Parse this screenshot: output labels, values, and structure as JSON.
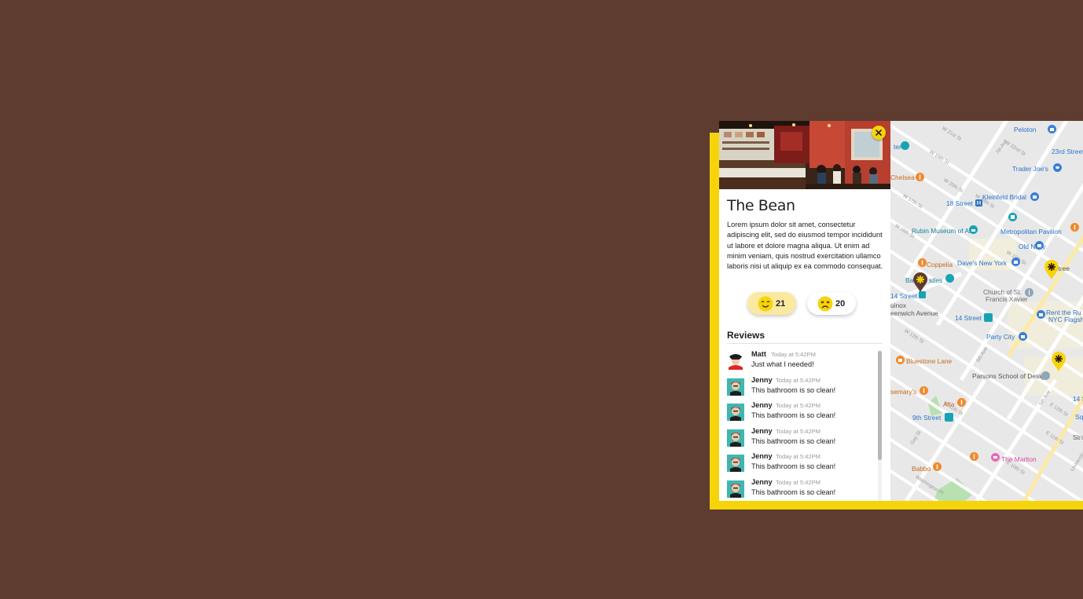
{
  "place": {
    "name": "The Bean",
    "description": "Lorem ipsum dolor sit amet, consectetur adipiscing elit, sed do eiusmod tempor incididunt ut labore et dolore magna aliqua. Ut enim ad minim veniam, quis nostrud exercitation ullamco laboris nisi ut aliquip ex ea commodo consequat."
  },
  "votes": {
    "up": {
      "icon": "smiling-face-icon",
      "count": "21"
    },
    "down": {
      "icon": "frowning-face-icon",
      "count": "20"
    }
  },
  "reviews": {
    "heading": "Reviews",
    "items": [
      {
        "author": "Matt",
        "time": "Today at 5:42PM",
        "text": "Just what I needed!",
        "avatar": "white-avatar"
      },
      {
        "author": "Jenny",
        "time": "Today at 5:42PM",
        "text": "This bathroom is so clean!",
        "avatar": "teal-avatar"
      },
      {
        "author": "Jenny",
        "time": "Today at 5:42PM",
        "text": "This bathroom is so clean!",
        "avatar": "teal-avatar"
      },
      {
        "author": "Jenny",
        "time": "Today at 5:42PM",
        "text": "This bathroom is so clean!",
        "avatar": "teal-avatar"
      },
      {
        "author": "Jenny",
        "time": "Today at 5:42PM",
        "text": "This bathroom is so clean!",
        "avatar": "teal-avatar"
      },
      {
        "author": "Jenny",
        "time": "Today at 5:42PM",
        "text": "This bathroom is so clean!",
        "avatar": "teal-avatar"
      }
    ]
  },
  "map": {
    "places": {
      "peloton": "Peloton",
      "twentythird": "23rd Street",
      "traderjoes": "Trader Joe's",
      "chelsea": "Chelsea",
      "kleinfeld": "Kleinfeld Bridal",
      "eighteenth": "18 Street",
      "rubin": "Rubin Museum of Art",
      "metropolitan": "Metropolitan Pavilion",
      "oldnavy": "Old Navy",
      "coppelia": "Coppelia",
      "davesny": "Dave's New York",
      "barnes": "Ba",
      "castles": "stles",
      "fourteenthA": "14 Street",
      "church1": "Church of St.",
      "church2": "Francis Xavier",
      "unox": "uinox",
      "greenwich": "eenwich Avenue",
      "fourteenthB": "14 Street",
      "rent1": "Rent the Ru",
      "rent2": "NYC Flagsh",
      "partycity": "Party City",
      "bluestone": "Bluestone Lane",
      "parsons": "Parsons School of Design",
      "rosemarys": "semary's",
      "alta": "Alta",
      "ninth": "9th Street",
      "marlton": "The Marlton",
      "babbo": "Babbo",
      "streetA": "Stree",
      "fourteenS": "14 S",
      "squ": "Squ",
      "stran": "Stran",
      "ter": "ter"
    },
    "streets": [
      "W 21st St",
      "W 22nd St",
      "W 20th St",
      "W 19th St",
      "W 18th St",
      "W 17th St",
      "W 16th St",
      "W 15th St",
      "E 13th St",
      "E 12th St",
      "E 11th St",
      "W 11th St",
      "E 10th St",
      "W 12th St",
      "7th Ave",
      "6th Ave",
      "5th Ave",
      "Washington Pl",
      "Gay St",
      "University Pl"
    ],
    "markers": [
      "bean-location-marker",
      "yellow-location-marker",
      "yellow-location-marker"
    ]
  },
  "colors": {
    "background": "#5e3c30",
    "accent_yellow": "#f6d40a",
    "marker_brown": "#5e3c30",
    "upvote_bg": "#fbe9a0",
    "map_water_blue": "#2a74c9"
  }
}
